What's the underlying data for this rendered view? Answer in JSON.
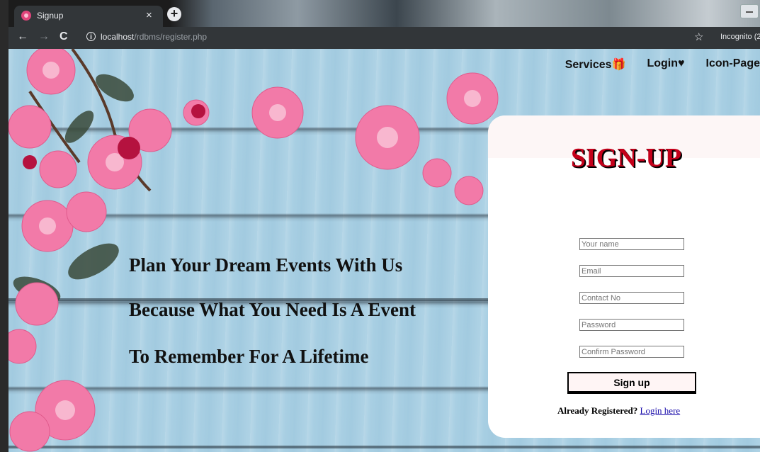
{
  "browser": {
    "tab_title": "Signup",
    "tab_close": "×",
    "new_tab": "+",
    "url_host": "localhost",
    "url_path": "/rdbms/register.php",
    "profile_label": "Incognito (2",
    "icons": [
      "back-arrow-icon",
      "forward-arrow-icon",
      "reload-icon",
      "info-icon",
      "star-icon",
      "close-icon",
      "plus-icon"
    ]
  },
  "nav": {
    "services": "Services🎁",
    "login": "Login♥",
    "icon_page": "Icon-Page"
  },
  "hero": {
    "line1": "Plan Your Dream Events With Us",
    "line2": "Because What You Need Is A Event",
    "line3": "To Remember For A Lifetime"
  },
  "form": {
    "title": "SIGN-UP",
    "name_placeholder": "Your name",
    "email_placeholder": "Email",
    "contact_placeholder": "Contact No",
    "password_placeholder": "Password",
    "confirm_placeholder": "Confirm Password",
    "submit_label": "Sign up",
    "already_text": "Already Registered?",
    "login_link": "Login here"
  },
  "colors": {
    "title_red": "#c4001a",
    "link_blue": "#1a0dab",
    "background_wood": "#a8cfe3",
    "flower_pink": "#f27aa8"
  }
}
